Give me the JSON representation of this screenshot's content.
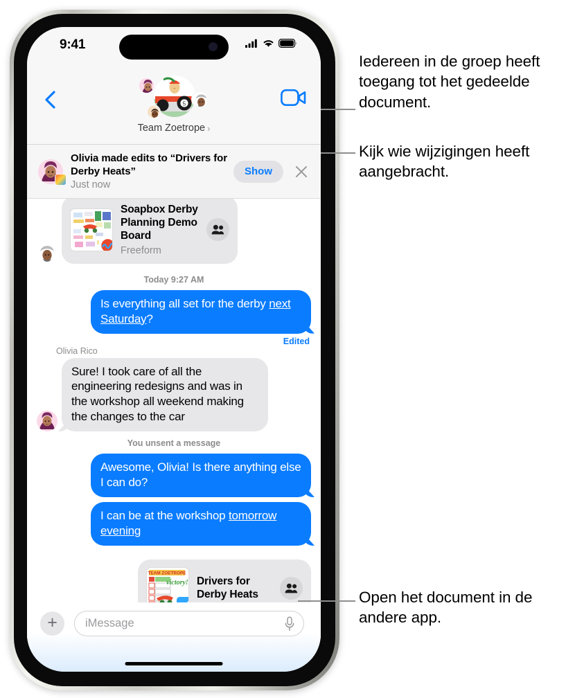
{
  "status_bar": {
    "time": "9:41",
    "icons": [
      "cellular-signal-icon",
      "wifi-icon",
      "battery-icon"
    ]
  },
  "nav_bar": {
    "back_icon": "chevron-left-icon",
    "facetime_icon": "video-camera-icon",
    "group_title": "Team Zoetrope",
    "group_chevron": "›",
    "avatars": [
      "memoji-olivia-avatar",
      "group-photo-soapbox-car-avatar",
      "memoji-gray-hat-avatar",
      "memoji-small-avatar"
    ]
  },
  "banner": {
    "title": "Olivia made edits to “Drivers for Derby Heats”",
    "subtitle": "Just now",
    "show_label": "Show",
    "close_icon": "close-x-icon",
    "avatar": "memoji-olivia-avatar",
    "app_badge": "freeform-app-badge"
  },
  "conversation": {
    "doc_card_top": {
      "title": "Soapbox Derby Planning Demo Board",
      "subtitle": "Freeform",
      "thumbnail": "freeform-board-thumbnail",
      "app_badge": "freeform-app-icon",
      "people_icon": "two-people-icon",
      "sender_avatar": "memoji-gray-hat-avatar"
    },
    "timestamp": "Today 9:27 AM",
    "messages": [
      {
        "type": "outgoing",
        "text_plain": "Is everything all set for the derby ",
        "text_link": "next Saturday",
        "text_tail": "?",
        "edited_label": "Edited"
      },
      {
        "type": "incoming",
        "sender": "Olivia Rico",
        "text": "Sure! I took care of all the engineering redesigns and was in the workshop all weekend making the changes to the car",
        "avatar": "memoji-olivia-avatar"
      },
      {
        "type": "system",
        "text": "You unsent a message"
      },
      {
        "type": "outgoing",
        "text_plain": "Awesome, Olivia! Is there anything else I can do?"
      },
      {
        "type": "outgoing",
        "text_plain": "I can be at the workshop ",
        "text_link": "tomorrow evening"
      }
    ],
    "doc_card_bottom": {
      "title": "Drivers for Derby Heats",
      "thumbnail": "derby-heats-chart-thumbnail",
      "app_badge": "freeform-app-icon",
      "people_icon": "two-people-icon"
    }
  },
  "input_bar": {
    "plus_icon": "plus-icon",
    "placeholder": "iMessage",
    "value": "",
    "mic_icon": "microphone-icon"
  },
  "callouts": [
    {
      "text": "Iedereen in de groep heeft toegang tot het gedeelde document."
    },
    {
      "text": "Kijk wie wijzigingen heeft aangebracht."
    },
    {
      "text": "Open het document in de andere app."
    }
  ],
  "colors": {
    "accent_blue": "#0a7cff",
    "bubble_gray": "#e7e7e9",
    "chrome_gray": "#f7f7f7",
    "secondary_text": "#8c8c8c",
    "leader_line": "#8e8e8e"
  }
}
